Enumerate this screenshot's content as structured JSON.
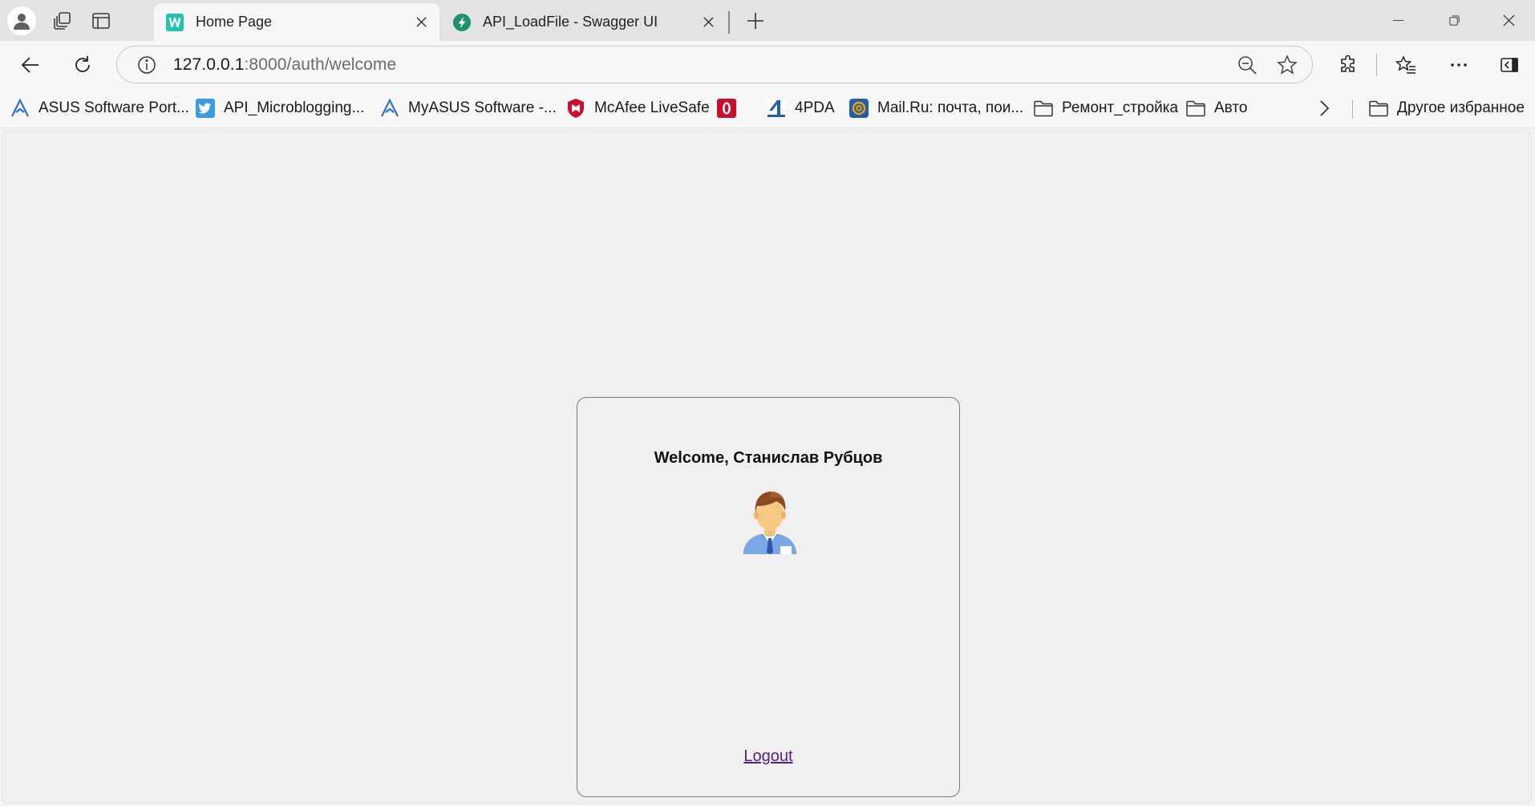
{
  "browser": {
    "tabs": [
      {
        "title": "Home Page",
        "active": true
      },
      {
        "title": "API_LoadFile - Swagger UI",
        "active": false
      }
    ],
    "address": {
      "host": "127.0.0.1",
      "path": ":8000/auth/welcome"
    },
    "bookmarks": [
      {
        "label": "ASUS Software Port...",
        "icon": "asus-icon"
      },
      {
        "label": "API_Microblogging...",
        "icon": "twitter-icon"
      },
      {
        "label": "MyASUS Software -...",
        "icon": "asus-icon"
      },
      {
        "label": "McAfee LiveSafe",
        "icon": "mcafee-icon"
      },
      {
        "label": "",
        "icon": "opera-icon"
      },
      {
        "label": "4PDA",
        "icon": "4pda-icon"
      },
      {
        "label": "Mail.Ru: почта, пои...",
        "icon": "mailru-icon"
      },
      {
        "label": "Ремонт_стройка",
        "icon": "folder-icon"
      },
      {
        "label": "Авто",
        "icon": "folder-icon"
      }
    ],
    "other_favorites": "Другое избранное"
  },
  "page": {
    "welcome_text": "Welcome, Станислав Рубцов",
    "logout_label": "Logout"
  },
  "colors": {
    "page_bg": "#f0f0f0",
    "visited_link": "#551a8b",
    "card_border": "#7a7a7a"
  }
}
